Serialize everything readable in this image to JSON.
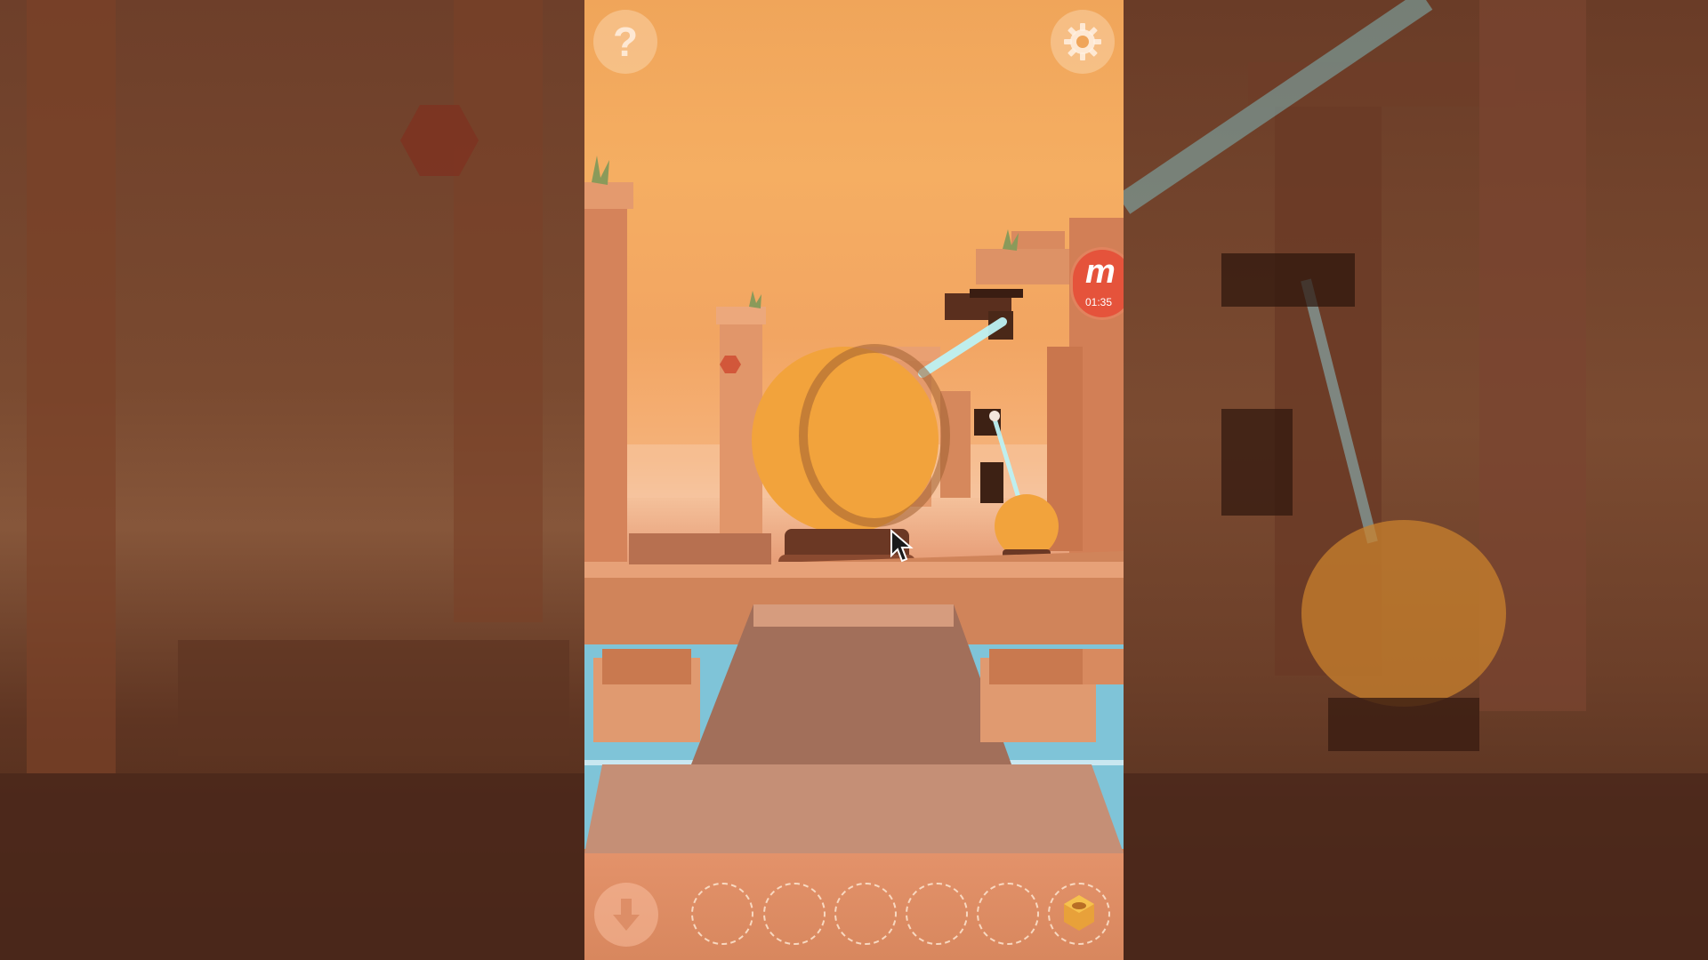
{
  "game": {
    "help_button": {
      "label": "?",
      "icon": "question-mark-icon"
    },
    "settings_button": {
      "icon": "gear-icon"
    },
    "recorder_badge": {
      "logo": "m",
      "timer": "01:35"
    },
    "inventory": {
      "back_button_icon": "arrow-down-icon",
      "slots": [
        {
          "state": "empty"
        },
        {
          "state": "empty"
        },
        {
          "state": "empty"
        },
        {
          "state": "empty"
        },
        {
          "state": "empty"
        },
        {
          "state": "filled",
          "item_icon": "hexagon-nut-icon"
        }
      ]
    }
  },
  "colors": {
    "sky": "#f5ae62",
    "laser_beam": "#bdf2f4",
    "orb": "#f2a33c",
    "stone": "#d98a60",
    "water": "#7fc4d8",
    "recorder_badge": "#e5533b"
  }
}
